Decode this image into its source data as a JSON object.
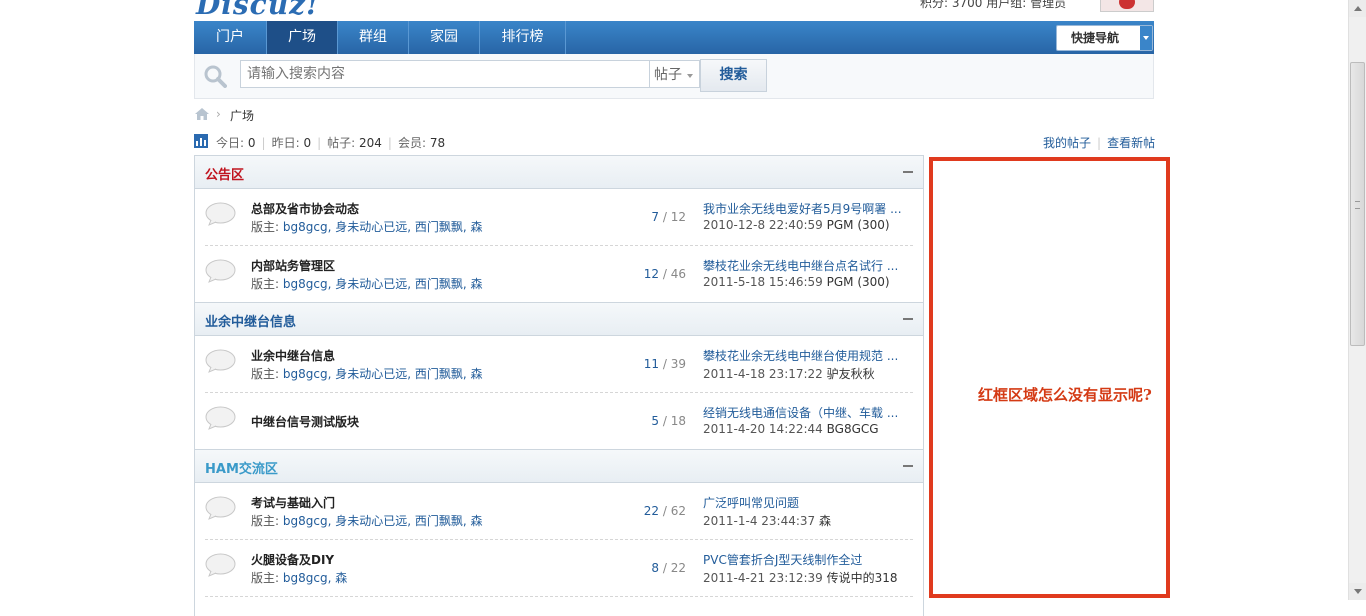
{
  "header": {
    "logo_text": "Discuz!",
    "user_info": "积分: 3700   用户组: 管理员"
  },
  "nav": {
    "items": [
      {
        "label": "门户"
      },
      {
        "label": "广场"
      },
      {
        "label": "群组"
      },
      {
        "label": "家园"
      },
      {
        "label": "排行榜"
      }
    ],
    "active_index": 1,
    "quick_nav_label": "快捷导航"
  },
  "search": {
    "placeholder": "请输入搜索内容",
    "type_label": "帖子",
    "button_label": "搜索"
  },
  "breadcrumb": {
    "separator": "›",
    "current": "广场"
  },
  "stats": {
    "today_label": "今日:",
    "today": "0",
    "yesterday_label": "昨日:",
    "yesterday": "0",
    "posts_label": "帖子:",
    "posts": "204",
    "members_label": "会员:",
    "members": "78"
  },
  "top_links": {
    "my_posts": "我的帖子",
    "new_posts": "查看新帖"
  },
  "categories": [
    {
      "title": "公告区",
      "color": "#c0141f",
      "forums": [
        {
          "name": "总部及省市协会动态",
          "mod_label": "版主:",
          "mods": "bg8gcg, 身未动心已远, 西门飘飘, 森",
          "threads": "7",
          "posts": "12",
          "last_title": "我市业余无线电爱好者5月9号啊署 ...",
          "last_time": "2010-12-8 22:40:59",
          "last_user": "PGM (300)"
        },
        {
          "name": "内部站务管理区",
          "mod_label": "版主:",
          "mods": "bg8gcg, 身未动心已远, 西门飘飘, 森",
          "threads": "12",
          "posts": "46",
          "last_title": "攀枝花业余无线电中继台点名试行 ...",
          "last_time": "2011-5-18 15:46:59",
          "last_user": "PGM (300)"
        }
      ]
    },
    {
      "title": "业余中继台信息",
      "color": "#225c9a",
      "forums": [
        {
          "name": "业余中继台信息",
          "mod_label": "版主:",
          "mods": "bg8gcg, 身未动心已远, 西门飘飘, 森",
          "threads": "11",
          "posts": "39",
          "last_title": "攀枝花业余无线电中继台使用规范 ...",
          "last_time": "2011-4-18 23:17:22",
          "last_user": "驴友秋秋"
        },
        {
          "name": "中继台信号测试版块",
          "mod_label": "",
          "mods": "",
          "threads": "5",
          "posts": "18",
          "last_title": "经销无线电通信设备（中继、车载 ...",
          "last_time": "2011-4-20 14:22:44",
          "last_user": "BG8GCG"
        }
      ]
    },
    {
      "title": "HAM交流区",
      "color": "#3a9ac9",
      "forums": [
        {
          "name": "考试与基础入门",
          "mod_label": "版主:",
          "mods": "bg8gcg, 身未动心已远, 西门飘飘, 森",
          "threads": "22",
          "posts": "62",
          "last_title": "广泛呼叫常见问题",
          "last_time": "2011-1-4 23:44:37",
          "last_user": "森"
        },
        {
          "name": "火腿设备及DIY",
          "mod_label": "版主:",
          "mods": "bg8gcg, 森",
          "threads": "8",
          "posts": "22",
          "last_title": "PVC管套折合J型天线制作全过",
          "last_time": "2011-4-21 23:12:39",
          "last_user": "传说中的318"
        }
      ]
    }
  ],
  "annotation": {
    "text": "红框区域怎么没有显示呢?",
    "box_color": "#e03a1e"
  }
}
